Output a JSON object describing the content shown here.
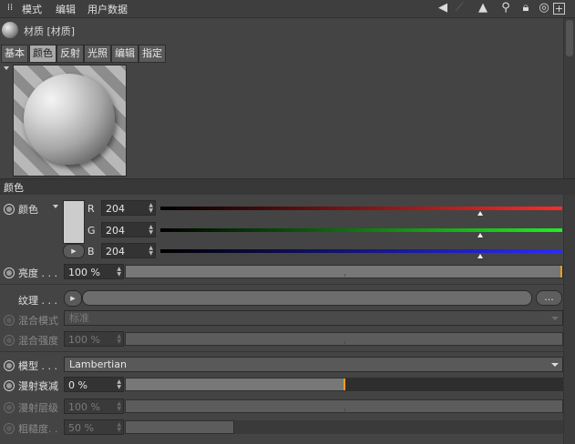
{
  "menu": {
    "modes": "模式",
    "edit": "编辑",
    "user_data": "用户数据"
  },
  "material": {
    "title": "材质 [材质]"
  },
  "tabs": [
    "基本",
    "颜色",
    "反射",
    "光照",
    "编辑",
    "指定"
  ],
  "section": {
    "title": "颜色"
  },
  "color": {
    "label": "颜色",
    "r_label": "R",
    "g_label": "G",
    "b_label": "B",
    "r": "204",
    "g": "204",
    "b": "204",
    "swatch": "#cccccc"
  },
  "brightness": {
    "label": "亮度 . . .",
    "value": "100 %",
    "fraction": 1.0
  },
  "texture": {
    "label": "纹理 . . .",
    "browse": "..."
  },
  "mix_mode": {
    "label": "混合模式",
    "value": "标准"
  },
  "mix_strength": {
    "label": "混合强度",
    "value": "100 %",
    "fraction": 1.0
  },
  "model": {
    "label": "模型 . . .",
    "value": "Lambertian"
  },
  "diffuse_falloff": {
    "label": "漫射衰减",
    "value": "0 %",
    "fraction": 0.5
  },
  "diffuse_level": {
    "label": "漫射层级",
    "value": "100 %",
    "fraction": 1.0
  },
  "roughness": {
    "label": "粗糙度. .",
    "value": "50 %",
    "fraction": 0.25
  },
  "colors": {
    "red": "#ff2a2a",
    "green": "#22ee22",
    "blue": "#2a2aff",
    "orange_marker": "#e8a020"
  }
}
